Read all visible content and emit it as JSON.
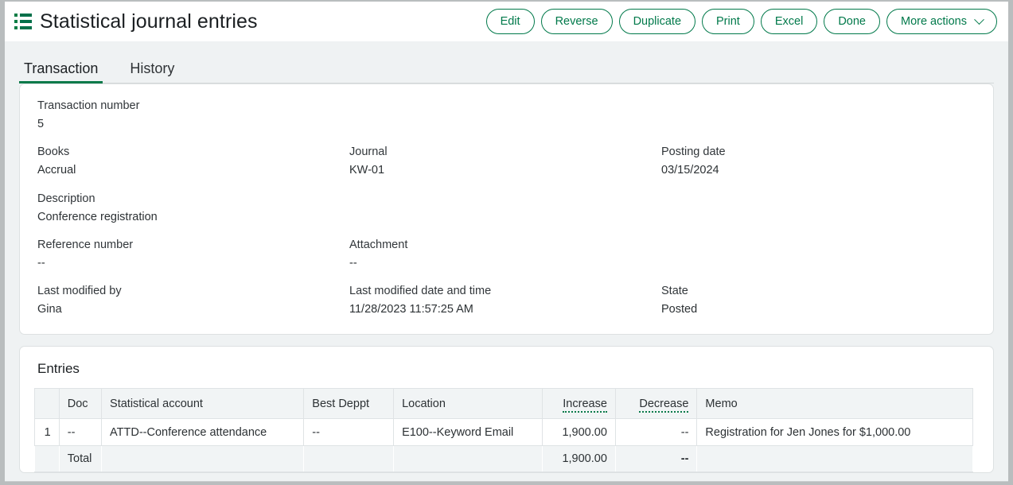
{
  "header": {
    "menu_icon": "list-menu-icon",
    "title": "Statistical journal entries",
    "buttons": [
      {
        "label": "Edit",
        "name": "edit"
      },
      {
        "label": "Reverse",
        "name": "reverse"
      },
      {
        "label": "Duplicate",
        "name": "duplicate"
      },
      {
        "label": "Print",
        "name": "print"
      },
      {
        "label": "Excel",
        "name": "excel"
      },
      {
        "label": "Done",
        "name": "done"
      }
    ],
    "more_actions": {
      "label": "More actions",
      "icon": "chevron-down-icon"
    }
  },
  "tabs": [
    {
      "label": "Transaction",
      "active": true
    },
    {
      "label": "History",
      "active": false
    }
  ],
  "detail": {
    "rows": [
      [
        {
          "label": "Transaction number",
          "value": "5"
        }
      ],
      [
        {
          "label": "Books",
          "value": "Accrual"
        },
        {
          "label": "Journal",
          "value": "KW-01"
        },
        {
          "label": "Posting date",
          "value": "03/15/2024"
        }
      ],
      [
        {
          "label": "Description",
          "value": "Conference registration"
        }
      ],
      [
        {
          "label": "Reference number",
          "value": "--"
        },
        {
          "label": "Attachment",
          "value": "--"
        }
      ],
      [
        {
          "label": "Last modified by",
          "value": "Gina"
        },
        {
          "label": "Last modified date and time",
          "value": "11/28/2023 11:57:25 AM"
        },
        {
          "label": "State",
          "value": "Posted"
        }
      ]
    ]
  },
  "entries": {
    "title": "Entries",
    "columns": [
      {
        "label": "",
        "key": "idx",
        "align": "right"
      },
      {
        "label": "Doc",
        "key": "doc",
        "align": "left"
      },
      {
        "label": "Statistical account",
        "key": "account",
        "align": "left"
      },
      {
        "label": "Best Deppt",
        "key": "dept",
        "align": "left"
      },
      {
        "label": "Location",
        "key": "location",
        "align": "left"
      },
      {
        "label": "Increase",
        "key": "increase",
        "align": "right",
        "hint": true
      },
      {
        "label": "Decrease",
        "key": "decrease",
        "align": "right",
        "hint": true
      },
      {
        "label": "Memo",
        "key": "memo",
        "align": "left"
      }
    ],
    "rows": [
      {
        "idx": "1",
        "doc": "--",
        "account": "ATTD--Conference attendance",
        "dept": "--",
        "location": "E100--Keyword Email",
        "increase": "1,900.00",
        "decrease": "--",
        "memo": "Registration for Jen Jones for $1,000.00"
      }
    ],
    "total": {
      "label": "Total",
      "increase": "1,900.00",
      "decrease": "--"
    }
  },
  "colors": {
    "brand_green": "#00794a",
    "accent_green": "#0a7a4a",
    "page_bg": "#eff2f3",
    "card_bg": "#ffffff",
    "header_bg": "#f1f4f5",
    "text": "#2c3134"
  }
}
